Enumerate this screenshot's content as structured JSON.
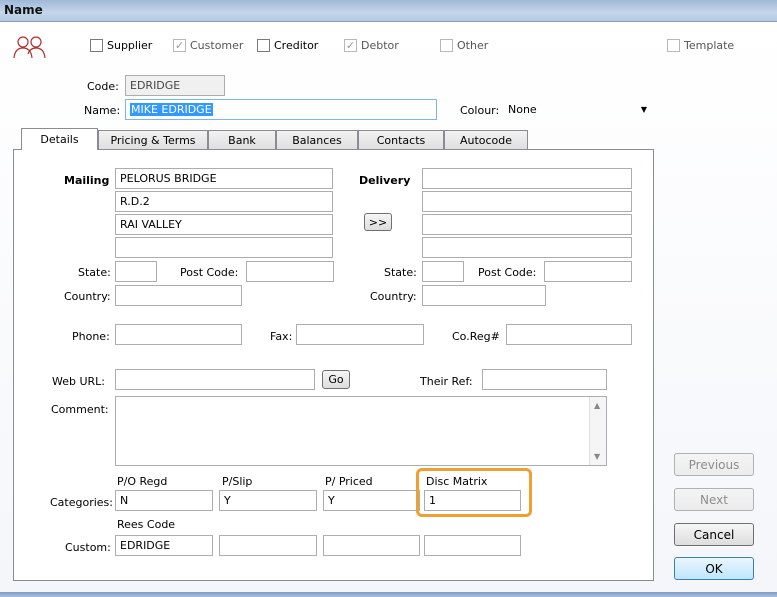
{
  "window": {
    "title": "Name"
  },
  "header_checks": {
    "supplier": {
      "label": "Supplier",
      "checked": false
    },
    "customer": {
      "label": "Customer",
      "checked": true
    },
    "creditor": {
      "label": "Creditor",
      "checked": false
    },
    "debtor": {
      "label": "Debtor",
      "checked": true
    },
    "other": {
      "label": "Other",
      "checked": false
    },
    "template": {
      "label": "Template",
      "checked": false
    }
  },
  "code": {
    "label": "Code:",
    "value": "EDRIDGE"
  },
  "name": {
    "label": "Name:",
    "value": "MIKE EDRIDGE"
  },
  "colour": {
    "label": "Colour:",
    "value": "None"
  },
  "tabs": [
    "Details",
    "Pricing & Terms",
    "Bank",
    "Balances",
    "Contacts",
    "Autocode"
  ],
  "mailing": {
    "label": "Mailing",
    "lines": [
      "PELORUS BRIDGE",
      "R.D.2",
      "RAI VALLEY",
      ""
    ],
    "state_label": "State:",
    "state": "",
    "postcode_label": "Post Code:",
    "postcode": "",
    "country_label": "Country:",
    "country": ""
  },
  "delivery": {
    "label": "Delivery",
    "copy_button": ">>",
    "lines": [
      "",
      "",
      "",
      ""
    ],
    "state_label": "State:",
    "state": "",
    "postcode_label": "Post Code:",
    "postcode": "",
    "country_label": "Country:",
    "country": ""
  },
  "contact": {
    "phone_label": "Phone:",
    "phone": "",
    "fax_label": "Fax:",
    "fax": "",
    "coreg_label": "Co.Reg#",
    "coreg": "",
    "web_label": "Web URL:",
    "web": "",
    "go_button": "Go",
    "theirref_label": "Their Ref:",
    "theirref": "",
    "comment_label": "Comment:",
    "comment": ""
  },
  "categories": {
    "label": "Categories:",
    "headers": [
      "P/O Regd",
      "P/Slip",
      "P/ Priced",
      "Disc Matrix"
    ],
    "values": [
      "N",
      "Y",
      "Y",
      "1"
    ]
  },
  "custom": {
    "label": "Custom:",
    "headers": [
      "Rees Code"
    ],
    "values": [
      "EDRIDGE",
      "",
      "",
      ""
    ]
  },
  "buttons": {
    "previous": "Previous",
    "next": "Next",
    "cancel": "Cancel",
    "ok": "OK"
  },
  "colors": {
    "highlight": "#f0a030",
    "selection": "#3399ff"
  }
}
